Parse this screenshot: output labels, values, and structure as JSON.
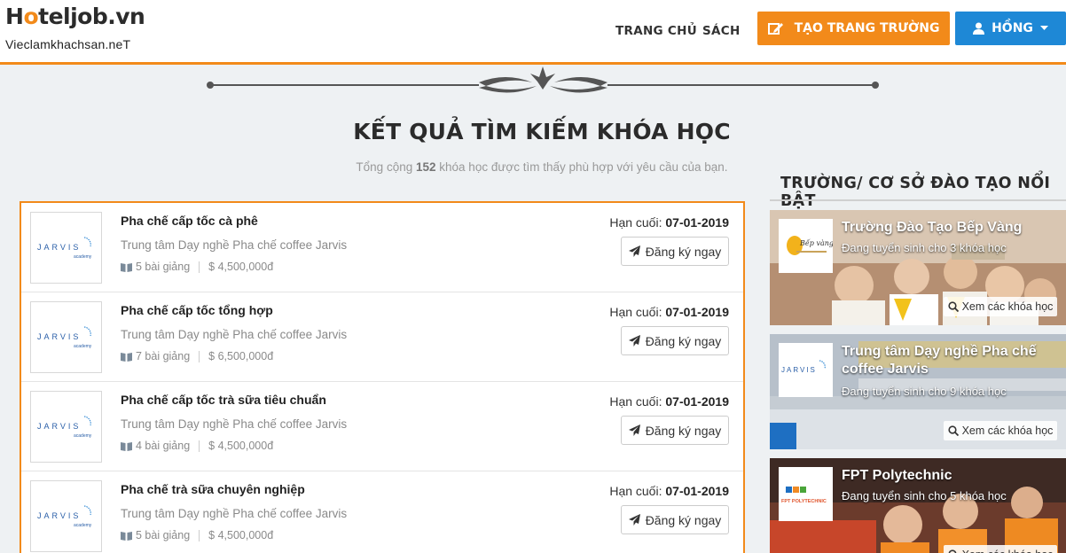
{
  "header": {
    "logo_main_prefix": "H",
    "logo_main_o": "o",
    "logo_main_suffix": "teljob.vn",
    "logo_sub": "Vieclamkhachsan.neT",
    "nav": [
      "TRANG CHỦ",
      "SÁCH"
    ],
    "create_button": "TẠO TRANG TRƯỜNG",
    "user_button": "HỒNG"
  },
  "page": {
    "title": "KẾT QUẢ TÌM KIẾM KHÓA HỌC",
    "subtitle_prefix": "Tổng cộng",
    "subtitle_count": "152",
    "subtitle_suffix": "khóa học được tìm thấy phù hợp với yêu cầu của bạn."
  },
  "courses": [
    {
      "title": "Pha chế cấp tốc cà phê",
      "center": "Trung tâm Dạy nghề Pha chế coffee Jarvis",
      "lessons": "5 bài giảng",
      "price": "$ 4,500,000đ",
      "deadline_label": "Hạn cuối:",
      "deadline": "07-01-2019",
      "button": "Đăng ký ngay"
    },
    {
      "title": "Pha chế cấp tốc tổng hợp",
      "center": "Trung tâm Dạy nghề Pha chế coffee Jarvis",
      "lessons": "7 bài giảng",
      "price": "$ 6,500,000đ",
      "deadline_label": "Hạn cuối:",
      "deadline": "07-01-2019",
      "button": "Đăng ký ngay"
    },
    {
      "title": "Pha chế cấp tốc trà sữa tiêu chuẩn",
      "center": "Trung tâm Dạy nghề Pha chế coffee Jarvis",
      "lessons": "4 bài giảng",
      "price": "$ 4,500,000đ",
      "deadline_label": "Hạn cuối:",
      "deadline": "07-01-2019",
      "button": "Đăng ký ngay"
    },
    {
      "title": "Pha chế trà sữa chuyên nghiệp",
      "center": "Trung tâm Dạy nghề Pha chế coffee Jarvis",
      "lessons": "5 bài giảng",
      "price": "$ 4,500,000đ",
      "deadline_label": "Hạn cuối:",
      "deadline": "07-01-2019",
      "button": "Đăng ký ngay"
    }
  ],
  "course_logo": {
    "text": "JARVIS",
    "sub": "academy"
  },
  "sidebar": {
    "title": "TRƯỜNG/ CƠ SỞ ĐÀO TẠO NỔI BẬT",
    "view_label": "Xem các khóa học",
    "schools": [
      {
        "name": "Trường Đào Tạo Bếp Vàng",
        "count": "Đang tuyển sinh cho 3 khóa học",
        "logo_text": "Bếp vàng"
      },
      {
        "name": "Trung tâm Dạy nghề Pha chế coffee Jarvis",
        "count": "Đang tuyển sinh cho 9 khóa học",
        "logo_text": "JARVIS"
      },
      {
        "name": "FPT Polytechnic",
        "count": "Đang tuyển sinh cho 5 khóa học",
        "logo_text": "FPT POLYTECHNIC"
      }
    ]
  },
  "colors": {
    "accent": "#f28a1a",
    "primary": "#1e88d6",
    "background": "#eef1f3"
  }
}
